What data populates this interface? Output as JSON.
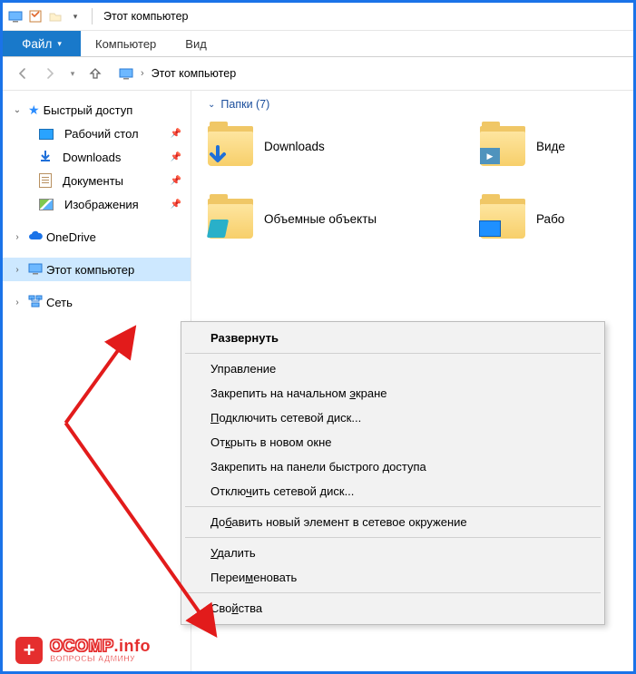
{
  "titlebar": {
    "title": "Этот компьютер"
  },
  "ribbon": {
    "file": "Файл",
    "tab_computer": "Компьютер",
    "tab_view": "Вид"
  },
  "breadcrumb": {
    "location": "Этот компьютер"
  },
  "sidebar": {
    "quick_access": "Быстрый доступ",
    "items": [
      {
        "label": "Рабочий стол"
      },
      {
        "label": "Downloads"
      },
      {
        "label": "Документы"
      },
      {
        "label": "Изображения"
      }
    ],
    "onedrive": "OneDrive",
    "this_pc": "Этот компьютер",
    "network": "Сеть"
  },
  "main": {
    "group_header": "Папки (7)",
    "folders": [
      {
        "label": "Downloads"
      },
      {
        "label": "Виде"
      },
      {
        "label": "Объемные объекты"
      },
      {
        "label": "Рабо"
      }
    ]
  },
  "context_menu": {
    "expand": "Развернуть",
    "manage": "Управление",
    "pin_start_pre": "Закрепить на начальном ",
    "pin_start_ul": "э",
    "pin_start_post": "кране",
    "map_drive_ul": "П",
    "map_drive_post": "одключить сетевой диск...",
    "open_new_pre": "От",
    "open_new_ul": "к",
    "open_new_post": "рыть в новом окне",
    "pin_quick": "Закрепить на панели быстрого доступа",
    "disconnect_pre": "Отклю",
    "disconnect_ul": "ч",
    "disconnect_post": "ить сетевой диск...",
    "add_net_pre": "До",
    "add_net_ul": "б",
    "add_net_post": "авить новый элемент в сетевое окружение",
    "delete_ul": "У",
    "delete_post": "далить",
    "rename_pre": "Переи",
    "rename_ul": "м",
    "rename_post": "еновать",
    "properties_pre": "Сво",
    "properties_ul": "й",
    "properties_post": "ства"
  },
  "watermark": {
    "line1_a": "OCOMP",
    "line1_b": ".info",
    "line2": "ВОПРОСЫ АДМИНУ"
  }
}
